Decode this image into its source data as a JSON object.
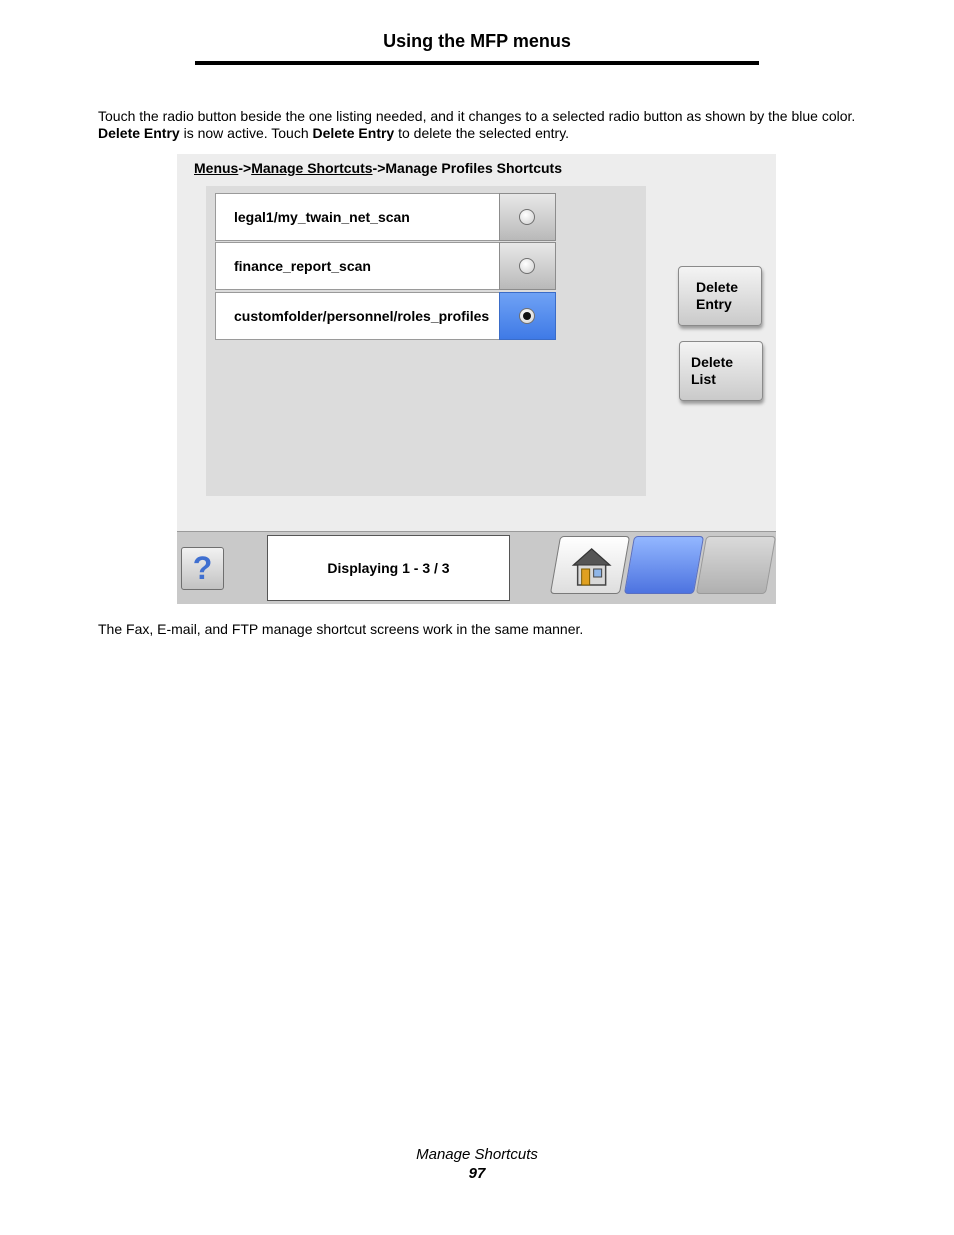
{
  "header": {
    "title": "Using the MFP menus"
  },
  "intro": {
    "sentence1": "Touch the radio button beside the one listing needed, and it changes to a selected radio button as shown by the blue color.",
    "bold1": "Delete Entry",
    "mid": " is now active. Touch ",
    "bold2": "Delete Entry",
    "end": " to delete the selected entry."
  },
  "panel": {
    "breadcrumb": {
      "menus": "Menus",
      "sep1": "->",
      "manage_shortcuts": "Manage Shortcuts",
      "sep2": "->",
      "current": "Manage Profiles Shortcuts"
    },
    "list": [
      {
        "label": "legal1/my_twain_net_scan",
        "selected": false
      },
      {
        "label": "finance_report_scan",
        "selected": false
      },
      {
        "label": "customfolder/personnel/roles_profiles",
        "selected": true
      }
    ],
    "buttons": {
      "delete_entry": "Delete Entry",
      "delete_list": "Delete List"
    },
    "status": "Displaying 1 - 3 / 3",
    "icons": {
      "help": "help-question-icon",
      "home": "home-icon"
    },
    "colors": {
      "selected_blue": "#4d7fe8"
    }
  },
  "outro": "The Fax, E-mail, and FTP manage shortcut screens work in the same manner.",
  "footer": {
    "section": "Manage Shortcuts",
    "page": "97"
  }
}
